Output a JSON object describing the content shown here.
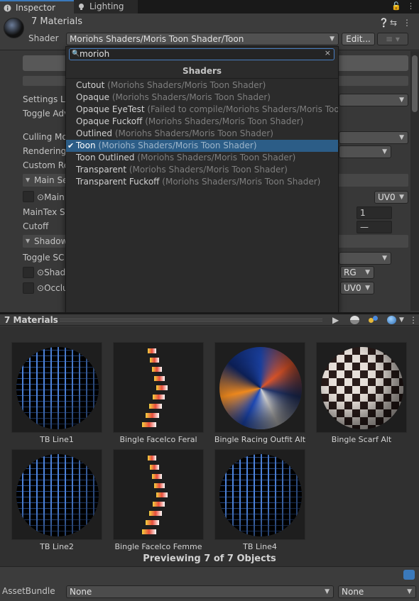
{
  "tabs": [
    {
      "label": "Inspector"
    },
    {
      "label": "Lighting"
    }
  ],
  "header": {
    "title": "7 Materials",
    "shader_label": "Shader",
    "shader_value": "Moriohs Shaders/Moris Toon Shader/Toon",
    "edit_label": "Edit..."
  },
  "inspector_rows": {
    "settings_level": "Settings Le",
    "toggle_adv": "Toggle Adv",
    "culling_mode": "Culling Mo",
    "rendering": "Rendering",
    "custom_render": "Custom Re",
    "main_section": "Main Se",
    "main_tex": "Main",
    "uv_main": "UV0",
    "maintex_s": "MainTex S",
    "maintex_s_value": "1",
    "cutoff": "Cutoff",
    "cutoff_value": "—",
    "shadow_section": "Shadow",
    "toggle_sc": "Toggle SC",
    "shad": "Shad",
    "shad_channel": "RG",
    "occlu": "Occlu",
    "occlu_uv": "UV0"
  },
  "search": {
    "value": "morioh"
  },
  "popup": {
    "title": "Shaders",
    "items": [
      {
        "name": "Cutout",
        "path": "(Moriohs Shaders/Moris Toon Shader)",
        "selected": false
      },
      {
        "name": "Opaque",
        "path": "(Moriohs Shaders/Moris Toon Shader)",
        "selected": false
      },
      {
        "name": "Opaque EyeTest",
        "path": "(Failed to compile/Moriohs Shaders/Moris Toon",
        "selected": false
      },
      {
        "name": "Opaque Fuckoff",
        "path": "(Moriohs Shaders/Moris Toon Shader)",
        "selected": false
      },
      {
        "name": "Outlined",
        "path": "(Moriohs Shaders/Moris Toon Shader)",
        "selected": false
      },
      {
        "name": "Toon",
        "path": "(Moriohs Shaders/Moris Toon Shader)",
        "selected": true
      },
      {
        "name": "Toon Outlined",
        "path": "(Moriohs Shaders/Moris Toon Shader)",
        "selected": false
      },
      {
        "name": "Transparent",
        "path": "(Moriohs Shaders/Moris Toon Shader)",
        "selected": false
      },
      {
        "name": "Transparent Fuckoff",
        "path": "(Moriohs Shaders/Moris Toon Shader)",
        "selected": false
      }
    ]
  },
  "preview": {
    "title": "7 Materials",
    "materials": [
      {
        "label": "TB Line1",
        "icon": "wireframe-sphere"
      },
      {
        "label": "Bingle FaceIco Feral",
        "icon": "face-strips"
      },
      {
        "label": "Bingle Racing Outfit Alt",
        "icon": "racing-sphere"
      },
      {
        "label": "Bingle Scarf Alt",
        "icon": "checker-sphere"
      },
      {
        "label": "TB Line2",
        "icon": "wireframe-sphere"
      },
      {
        "label": "Bingle FaceIco Femme",
        "icon": "face-strips"
      },
      {
        "label": "TB Line4",
        "icon": "wireframe-sphere"
      }
    ],
    "footer": "Previewing 7 of 7 Objects"
  },
  "assetbundle": {
    "label": "AssetBundle",
    "name": "None",
    "variant": "None"
  }
}
